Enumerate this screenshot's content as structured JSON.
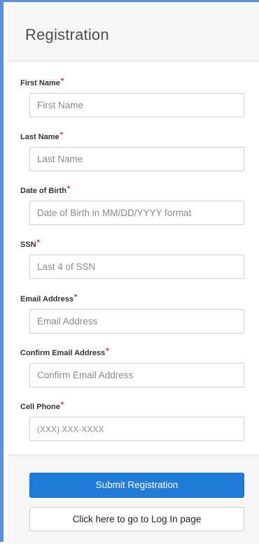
{
  "header": {
    "title": "Registration"
  },
  "required_marker": "*",
  "fields": [
    {
      "label": "First Name",
      "placeholder": "First Name",
      "value": ""
    },
    {
      "label": "Last Name",
      "placeholder": "Last Name",
      "value": ""
    },
    {
      "label": "Date of Birth",
      "placeholder": "Date of Birth in MM/DD/YYYY format",
      "value": ""
    },
    {
      "label": "SSN",
      "placeholder": "Last 4 of SSN",
      "value": ""
    },
    {
      "label": "Email Address",
      "placeholder": "Email Address",
      "value": ""
    },
    {
      "label": "Confirm Email Address",
      "placeholder": "Confirm Email Address",
      "value": ""
    },
    {
      "label": "Cell Phone",
      "placeholder": "(XXX) XXX-XXXX",
      "value": ""
    }
  ],
  "actions": {
    "submit_label": "Submit Registration",
    "login_link_label": "Click here to go to Log In page"
  },
  "colors": {
    "accent": "#1f7bd6",
    "frame_border": "#5b8fd8",
    "required": "#e02424",
    "panel_bg": "#f6f6f6"
  }
}
